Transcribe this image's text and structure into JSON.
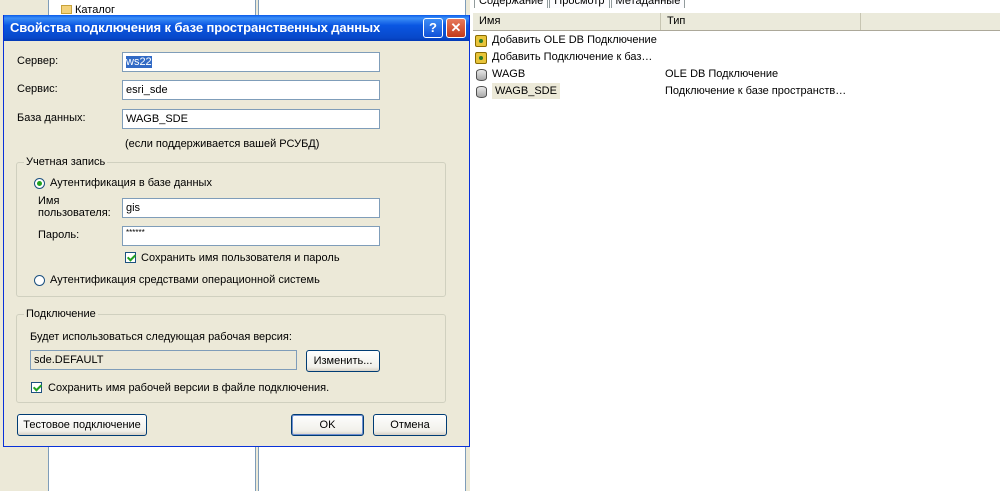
{
  "background": {
    "tree_item": "Каталог",
    "tabs": [
      "Содержание",
      "Просмотр",
      "Метаданные"
    ],
    "columns": {
      "name": "Имя",
      "type": "Тип"
    },
    "rows": [
      {
        "name": "Добавить OLE DB Подключение",
        "type": "",
        "icon": "add-connection-icon"
      },
      {
        "name": "Добавить Подключение к баз…",
        "type": "",
        "icon": "add-connection-icon"
      },
      {
        "name": "WAGB",
        "type": "OLE DB Подключение",
        "icon": "database-icon"
      },
      {
        "name": "WAGB_SDE",
        "type": "Подключение к базе пространств…",
        "icon": "database-icon",
        "selected": true
      }
    ]
  },
  "dialog": {
    "title": "Свойства подключения к базе пространственных данных",
    "help_button": "?",
    "close_button": "✕",
    "server_label": "Сервер:",
    "server_value": "ws22",
    "service_label": "Сервис:",
    "service_value": "esri_sde",
    "database_label": "База данных:",
    "database_value": "WAGB_SDE",
    "database_hint": "(если поддерживается вашей РСУБД)",
    "account": {
      "title": "Учетная запись",
      "db_auth_label": "Аутентификация в базе данных",
      "db_auth_selected": true,
      "username_label": "Имя пользователя:",
      "username_value": "gis",
      "password_label": "Пароль:",
      "password_value": "******",
      "save_credentials_label": "Сохранить имя пользователя и пароль",
      "save_credentials_checked": true,
      "os_auth_label": "Аутентификация средствами операционной системь"
    },
    "connection": {
      "title": "Подключение",
      "version_label": "Будет использоваться следующая рабочая версия:",
      "version_value": "sde.DEFAULT",
      "change_button": "Изменить...",
      "save_version_label": "Сохранить имя рабочей версии в файле подключения.",
      "save_version_checked": true
    },
    "test_button": "Тестовое подключение",
    "ok_button": "OK",
    "cancel_button": "Отмена"
  },
  "colors": {
    "titlebar": "#0a56e2",
    "dialog_bg": "#ece9d8",
    "selection": "#316ac5",
    "close_button": "#c3391a"
  }
}
